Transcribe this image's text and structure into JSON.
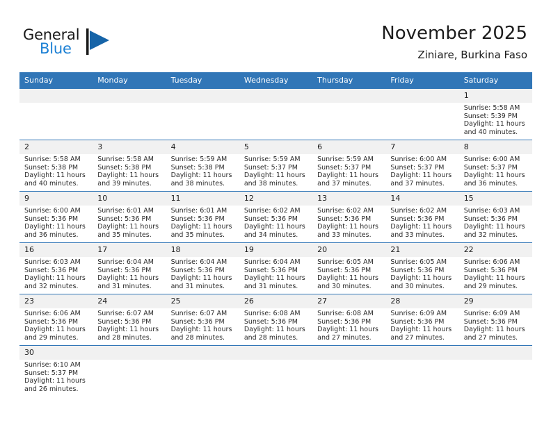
{
  "brand": {
    "name_top": "General",
    "name_bottom": "Blue",
    "mark": "flag-triangle-icon",
    "color_dark": "#1a1a1a",
    "color_blue": "#1a7fd4"
  },
  "header": {
    "title": "November 2025",
    "subtitle": "Ziniare, Burkina Faso"
  },
  "theme": {
    "header_blue": "#3176b7",
    "daynum_bg": "#f1f1f1",
    "text": "#1c1c1c"
  },
  "calendar": {
    "weekday_headers": [
      "Sunday",
      "Monday",
      "Tuesday",
      "Wednesday",
      "Thursday",
      "Friday",
      "Saturday"
    ],
    "labels": {
      "sunrise": "Sunrise:",
      "sunset": "Sunset:",
      "daylight": "Daylight:"
    },
    "weeks": [
      [
        {
          "day": "",
          "blank": true
        },
        {
          "day": "",
          "blank": true
        },
        {
          "day": "",
          "blank": true
        },
        {
          "day": "",
          "blank": true
        },
        {
          "day": "",
          "blank": true
        },
        {
          "day": "",
          "blank": true
        },
        {
          "day": "1",
          "sunrise": "Sunrise: 5:58 AM",
          "sunset": "Sunset: 5:39 PM",
          "daylight": "Daylight: 11 hours and 40 minutes."
        }
      ],
      [
        {
          "day": "2",
          "sunrise": "Sunrise: 5:58 AM",
          "sunset": "Sunset: 5:38 PM",
          "daylight": "Daylight: 11 hours and 40 minutes."
        },
        {
          "day": "3",
          "sunrise": "Sunrise: 5:58 AM",
          "sunset": "Sunset: 5:38 PM",
          "daylight": "Daylight: 11 hours and 39 minutes."
        },
        {
          "day": "4",
          "sunrise": "Sunrise: 5:59 AM",
          "sunset": "Sunset: 5:38 PM",
          "daylight": "Daylight: 11 hours and 38 minutes."
        },
        {
          "day": "5",
          "sunrise": "Sunrise: 5:59 AM",
          "sunset": "Sunset: 5:37 PM",
          "daylight": "Daylight: 11 hours and 38 minutes."
        },
        {
          "day": "6",
          "sunrise": "Sunrise: 5:59 AM",
          "sunset": "Sunset: 5:37 PM",
          "daylight": "Daylight: 11 hours and 37 minutes."
        },
        {
          "day": "7",
          "sunrise": "Sunrise: 6:00 AM",
          "sunset": "Sunset: 5:37 PM",
          "daylight": "Daylight: 11 hours and 37 minutes."
        },
        {
          "day": "8",
          "sunrise": "Sunrise: 6:00 AM",
          "sunset": "Sunset: 5:37 PM",
          "daylight": "Daylight: 11 hours and 36 minutes."
        }
      ],
      [
        {
          "day": "9",
          "sunrise": "Sunrise: 6:00 AM",
          "sunset": "Sunset: 5:36 PM",
          "daylight": "Daylight: 11 hours and 36 minutes."
        },
        {
          "day": "10",
          "sunrise": "Sunrise: 6:01 AM",
          "sunset": "Sunset: 5:36 PM",
          "daylight": "Daylight: 11 hours and 35 minutes."
        },
        {
          "day": "11",
          "sunrise": "Sunrise: 6:01 AM",
          "sunset": "Sunset: 5:36 PM",
          "daylight": "Daylight: 11 hours and 35 minutes."
        },
        {
          "day": "12",
          "sunrise": "Sunrise: 6:02 AM",
          "sunset": "Sunset: 5:36 PM",
          "daylight": "Daylight: 11 hours and 34 minutes."
        },
        {
          "day": "13",
          "sunrise": "Sunrise: 6:02 AM",
          "sunset": "Sunset: 5:36 PM",
          "daylight": "Daylight: 11 hours and 33 minutes."
        },
        {
          "day": "14",
          "sunrise": "Sunrise: 6:02 AM",
          "sunset": "Sunset: 5:36 PM",
          "daylight": "Daylight: 11 hours and 33 minutes."
        },
        {
          "day": "15",
          "sunrise": "Sunrise: 6:03 AM",
          "sunset": "Sunset: 5:36 PM",
          "daylight": "Daylight: 11 hours and 32 minutes."
        }
      ],
      [
        {
          "day": "16",
          "sunrise": "Sunrise: 6:03 AM",
          "sunset": "Sunset: 5:36 PM",
          "daylight": "Daylight: 11 hours and 32 minutes."
        },
        {
          "day": "17",
          "sunrise": "Sunrise: 6:04 AM",
          "sunset": "Sunset: 5:36 PM",
          "daylight": "Daylight: 11 hours and 31 minutes."
        },
        {
          "day": "18",
          "sunrise": "Sunrise: 6:04 AM",
          "sunset": "Sunset: 5:36 PM",
          "daylight": "Daylight: 11 hours and 31 minutes."
        },
        {
          "day": "19",
          "sunrise": "Sunrise: 6:04 AM",
          "sunset": "Sunset: 5:36 PM",
          "daylight": "Daylight: 11 hours and 31 minutes."
        },
        {
          "day": "20",
          "sunrise": "Sunrise: 6:05 AM",
          "sunset": "Sunset: 5:36 PM",
          "daylight": "Daylight: 11 hours and 30 minutes."
        },
        {
          "day": "21",
          "sunrise": "Sunrise: 6:05 AM",
          "sunset": "Sunset: 5:36 PM",
          "daylight": "Daylight: 11 hours and 30 minutes."
        },
        {
          "day": "22",
          "sunrise": "Sunrise: 6:06 AM",
          "sunset": "Sunset: 5:36 PM",
          "daylight": "Daylight: 11 hours and 29 minutes."
        }
      ],
      [
        {
          "day": "23",
          "sunrise": "Sunrise: 6:06 AM",
          "sunset": "Sunset: 5:36 PM",
          "daylight": "Daylight: 11 hours and 29 minutes."
        },
        {
          "day": "24",
          "sunrise": "Sunrise: 6:07 AM",
          "sunset": "Sunset: 5:36 PM",
          "daylight": "Daylight: 11 hours and 28 minutes."
        },
        {
          "day": "25",
          "sunrise": "Sunrise: 6:07 AM",
          "sunset": "Sunset: 5:36 PM",
          "daylight": "Daylight: 11 hours and 28 minutes."
        },
        {
          "day": "26",
          "sunrise": "Sunrise: 6:08 AM",
          "sunset": "Sunset: 5:36 PM",
          "daylight": "Daylight: 11 hours and 28 minutes."
        },
        {
          "day": "27",
          "sunrise": "Sunrise: 6:08 AM",
          "sunset": "Sunset: 5:36 PM",
          "daylight": "Daylight: 11 hours and 27 minutes."
        },
        {
          "day": "28",
          "sunrise": "Sunrise: 6:09 AM",
          "sunset": "Sunset: 5:36 PM",
          "daylight": "Daylight: 11 hours and 27 minutes."
        },
        {
          "day": "29",
          "sunrise": "Sunrise: 6:09 AM",
          "sunset": "Sunset: 5:36 PM",
          "daylight": "Daylight: 11 hours and 27 minutes."
        }
      ],
      [
        {
          "day": "30",
          "sunrise": "Sunrise: 6:10 AM",
          "sunset": "Sunset: 5:37 PM",
          "daylight": "Daylight: 11 hours and 26 minutes."
        },
        {
          "day": "",
          "blank": true
        },
        {
          "day": "",
          "blank": true
        },
        {
          "day": "",
          "blank": true
        },
        {
          "day": "",
          "blank": true
        },
        {
          "day": "",
          "blank": true
        },
        {
          "day": "",
          "blank": true
        }
      ]
    ]
  }
}
